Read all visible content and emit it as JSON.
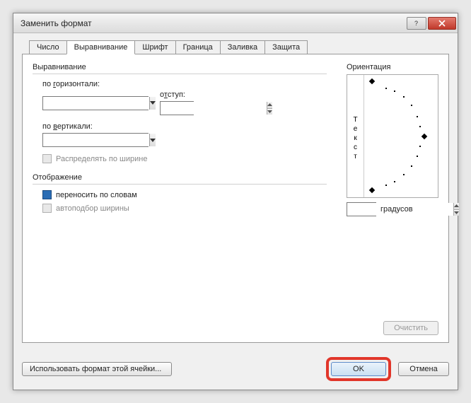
{
  "window": {
    "title": "Заменить формат"
  },
  "tabs": [
    "Число",
    "Выравнивание",
    "Шрифт",
    "Граница",
    "Заливка",
    "Защита"
  ],
  "active_tab": 1,
  "align": {
    "group_label": "Выравнивание",
    "horizontal_label": "по горизонтали:",
    "indent_label": "отступ:",
    "vertical_label": "по вертикали:",
    "distribute_label": "Распределять по ширине"
  },
  "display": {
    "group_label": "Отображение",
    "wrap_label": "переносить по словам",
    "autofit_label": "автоподбор ширины"
  },
  "orientation": {
    "group_label": "Ориентация",
    "vertical_text": "Текст",
    "degrees_label": "градусов"
  },
  "buttons": {
    "clear": "Очистить",
    "use_cell_format": "Использовать формат этой ячейки...",
    "ok": "OK",
    "cancel": "Отмена"
  }
}
